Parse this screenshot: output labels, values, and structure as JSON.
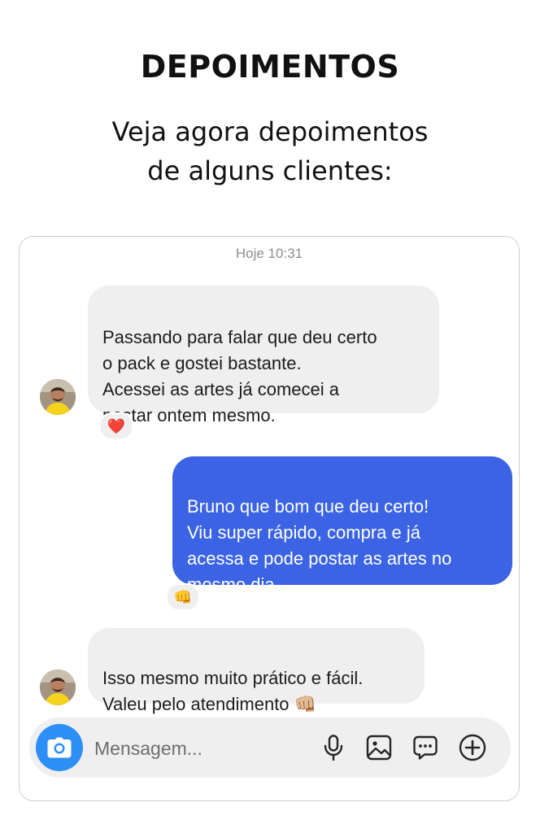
{
  "header": {
    "title": "DEPOIMENTOS",
    "subtitle": "Veja agora depoimentos\nde alguns clientes:"
  },
  "chat": {
    "timestamp": "Hoje 10:31",
    "messages": [
      {
        "direction": "incoming",
        "text": "Passando para falar que deu certo\no pack e gostei bastante.\nAcessei as artes já comecei a\npostar ontem mesmo.",
        "reaction": "❤️"
      },
      {
        "direction": "outgoing",
        "text": "Bruno que bom que deu certo!\nViu super rápido, compra e já\nacessa e pode postar as artes no\nmesmo dia.",
        "reaction": "👊"
      },
      {
        "direction": "incoming",
        "text": "Isso mesmo muito prático e fácil.\nValeu pelo atendimento 👊🏼"
      }
    ]
  },
  "composer": {
    "placeholder": "Mensagem...",
    "icons": [
      "camera-icon",
      "microphone-icon",
      "image-icon",
      "sticker-chat-icon",
      "plus-circle-icon"
    ]
  },
  "colors": {
    "outgoing_bubble": "#3b63e3",
    "incoming_bubble": "#efefef",
    "camera_button": "#2d8ff5"
  }
}
